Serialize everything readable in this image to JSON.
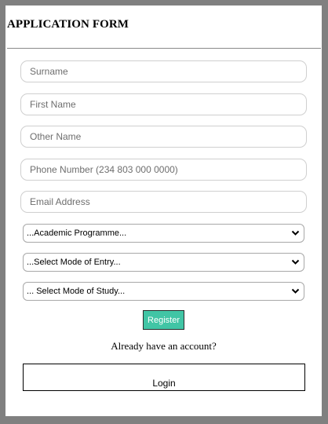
{
  "form": {
    "title": "APPLICATION FORM"
  },
  "fields": {
    "surname_placeholder": "Surname",
    "first_name_placeholder": "First Name",
    "other_name_placeholder": "Other Name",
    "phone_placeholder": "Phone Number (234 803 000 0000)",
    "email_placeholder": "Email Address"
  },
  "selects": {
    "programme": "...Academic Programme...",
    "entry_mode": "...Select Mode of Entry...",
    "study_mode": "... Select Mode of Study..."
  },
  "actions": {
    "register_label": "Register",
    "account_prompt": "Already have an account?",
    "login_label": "Login"
  },
  "icons": {
    "select_chevron": "chevron-down-icon"
  },
  "colors": {
    "register_accent": "#41c5a5",
    "page_background": "#808080",
    "card_background": "#ffffff"
  }
}
